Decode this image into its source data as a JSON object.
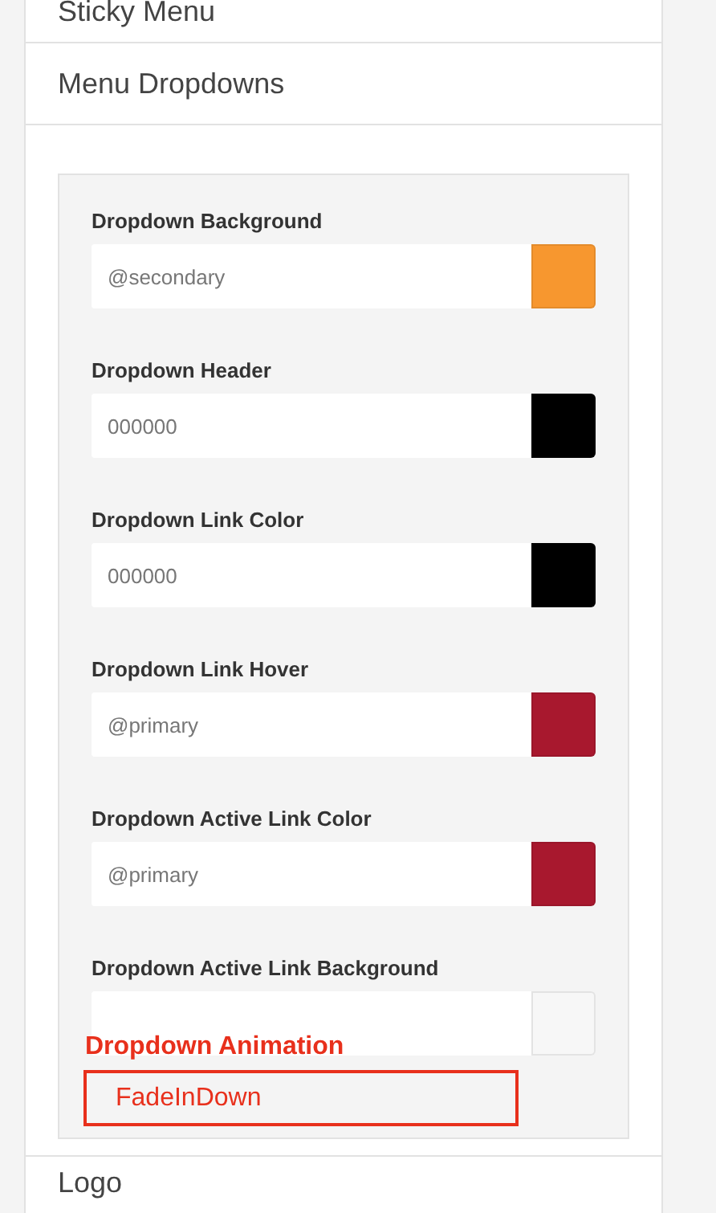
{
  "sections": [
    {
      "title": "Sticky Menu"
    },
    {
      "title": "Menu Dropdowns"
    }
  ],
  "color_fields": [
    {
      "label": "Dropdown Background",
      "value": "@secondary",
      "color": "#f7972f"
    },
    {
      "label": "Dropdown Header",
      "value": "000000",
      "color": "#000000"
    },
    {
      "label": "Dropdown Link Color",
      "value": "000000",
      "color": "#000000"
    },
    {
      "label": "Dropdown Link Hover",
      "value": "@primary",
      "color": "#a8182e"
    },
    {
      "label": "Dropdown Active Link Color",
      "value": "@primary",
      "color": "#a8182e"
    },
    {
      "label": "Dropdown Active Link Background",
      "color": "#f7f7f7"
    }
  ],
  "animation": {
    "label": "Dropdown Animation",
    "value": "FadeInDown"
  },
  "next_section": {
    "title": "Logo"
  }
}
